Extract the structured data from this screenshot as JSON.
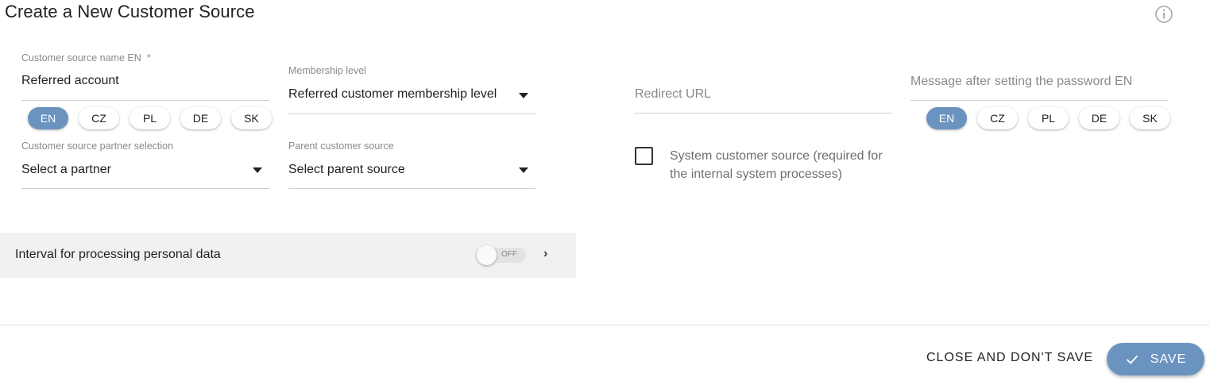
{
  "page": {
    "title": "Create a New Customer Source",
    "info_icon": "info-circle-icon"
  },
  "form": {
    "name": {
      "label": "Customer source name EN",
      "required_mark": "*",
      "value": "Referred account",
      "languages": [
        "EN",
        "CZ",
        "PL",
        "DE",
        "SK"
      ],
      "active_language": "EN"
    },
    "membership_level": {
      "label": "Membership level",
      "value": "Referred customer membership level"
    },
    "redirect_url": {
      "placeholder": "Redirect URL"
    },
    "password_message": {
      "placeholder": "Message after setting the password EN",
      "languages": [
        "EN",
        "CZ",
        "PL",
        "DE",
        "SK"
      ],
      "active_language": "EN"
    },
    "partner": {
      "label": "Customer source partner selection",
      "value": "Select a partner"
    },
    "parent_source": {
      "label": "Parent customer source",
      "value": "Select parent source"
    },
    "system_source": {
      "label": "System customer source (required for the internal system processes)",
      "checked": false
    }
  },
  "panel": {
    "label": "Interval for processing personal data",
    "toggle_text": "OFF",
    "toggle_on": false
  },
  "footer": {
    "close_label": "CLOSE AND DON'T SAVE",
    "save_label": "SAVE",
    "accent_color": "#6b93c0"
  }
}
